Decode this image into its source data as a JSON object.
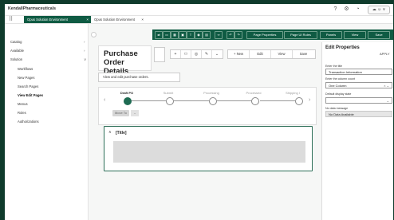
{
  "app": {
    "brand": "KendallPharmaceuticals",
    "profile_label": "☁ ☺ ∨"
  },
  "tabs": [
    {
      "label": "Opus Solution Environment",
      "close": "×"
    },
    {
      "label": "Opus Solution Environment",
      "close": "×"
    }
  ],
  "sidebar": {
    "items": [
      {
        "label": "Catalog",
        "chevron": "›"
      },
      {
        "label": "Available",
        "chevron": "›"
      },
      {
        "label": "Solution",
        "chevron": "∨"
      },
      {
        "label": "Workflows"
      },
      {
        "label": "New Pages"
      },
      {
        "label": "Search Pages"
      },
      {
        "label": "View Edit Pages"
      },
      {
        "label": "Menus"
      },
      {
        "label": "Roles"
      },
      {
        "label": "Authorizations"
      }
    ]
  },
  "toolbar": {
    "page_properties": "Page Properties",
    "page_ui_rules": "Page UI Rules",
    "panels": "Panels",
    "view": "View",
    "save": "Save"
  },
  "page": {
    "title": "Purchase Order Details",
    "description": "View and edit purchase orders."
  },
  "actions": {
    "new": "+ New",
    "edit": "Edit",
    "view": "View",
    "save": "Save"
  },
  "stages": [
    {
      "label": "Draft PO",
      "active": true
    },
    {
      "label": "Submit",
      "active": false
    },
    {
      "label": "Processing",
      "active": false
    },
    {
      "label": "Processed",
      "active": false
    },
    {
      "label": "Shipping I",
      "active": false
    }
  ],
  "move_button": "Move To",
  "section": {
    "title": "[Title]"
  },
  "edit_properties": {
    "title": "Edit Properties",
    "apply": "APPLY",
    "title_label": "Enter the title",
    "title_value": "Transaction Information",
    "columns_label": "Enter the column count",
    "columns_value": "One Column",
    "display_label": "Default display state",
    "display_value": "",
    "nodata_label": "No data message",
    "nodata_value": "No Data Available"
  },
  "colors": {
    "brand_green": "#0f5b43",
    "background_green": "#0f3b2c"
  }
}
